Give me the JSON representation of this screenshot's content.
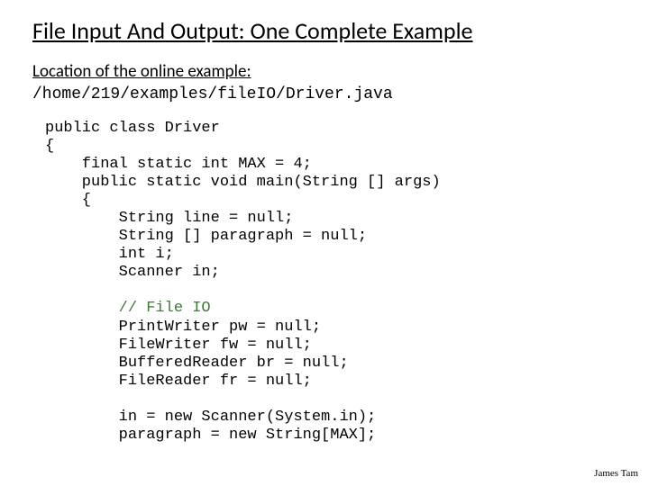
{
  "title": "File Input And Output: One Complete Example",
  "location_label": "Location of the online example:",
  "path": "/home/219/examples/fileIO/Driver.java",
  "code": {
    "l1": "public class Driver",
    "l2": "{",
    "l3": "    final static int MAX = 4;",
    "l4": "    public static void main(String [] args)",
    "l5": "    {",
    "l6": "        String line = null;",
    "l7": "        String [] paragraph = null;",
    "l8": "        int i;",
    "l9": "        Scanner in;",
    "comment": "        // File IO",
    "l11": "        PrintWriter pw = null;",
    "l12": "        FileWriter fw = null;",
    "l13": "        BufferedReader br = null;",
    "l14": "        FileReader fr = null;",
    "l16": "        in = new Scanner(System.in);",
    "l17": "        paragraph = new String[MAX];"
  },
  "footer": "James Tam"
}
